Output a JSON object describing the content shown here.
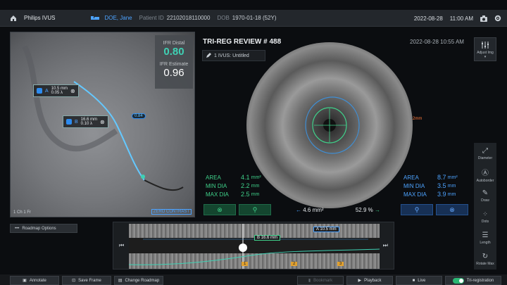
{
  "topbar": {
    "brand": "Philips IVUS",
    "patient_name": "DOE, Jane",
    "patient_id_label": "Patient ID",
    "patient_id": "22102018110000",
    "dob_label": "DOB",
    "dob": "1970-01-18 (52Y)",
    "date": "2022-08-28",
    "time": "11:00 AM"
  },
  "angio": {
    "ifr_distal_label": "IFR Distal",
    "ifr_distal_value": "0.80",
    "ifr_estimate_label": "IFR Estimate",
    "ifr_estimate_value": "0.96",
    "meas_a": {
      "letter": "A",
      "length": "10.5 mm",
      "value": "0.05 λ"
    },
    "meas_b": {
      "letter": "B",
      "length": "16.6 mm",
      "value": "0.10 λ"
    },
    "callout": "0.84",
    "zero_contrast": "ZERO CONTRAST",
    "frame_info": "1 Ch 1 Fr"
  },
  "review": {
    "title": "TRI-REG REVIEW # 488",
    "date": "2022-08-28 10:55 AM",
    "ivus_label": "1 IVUS: Untitled",
    "scale_label": "2mm"
  },
  "adjust": {
    "label": "Adjust Img"
  },
  "stats_left": [
    {
      "key": "AREA",
      "value": "4.1",
      "unit": "mm²"
    },
    {
      "key": "MIN DIA",
      "value": "2.2",
      "unit": "mm"
    },
    {
      "key": "MAX DIA",
      "value": "2.5",
      "unit": "mm"
    }
  ],
  "stats_right": [
    {
      "key": "AREA",
      "value": "8.7",
      "unit": "mm²"
    },
    {
      "key": "MIN DIA",
      "value": "3.5",
      "unit": "mm"
    },
    {
      "key": "MAX DIA",
      "value": "3.9",
      "unit": "mm"
    }
  ],
  "center_stats": {
    "area": "4.6 mm²",
    "percent": "52.9 %"
  },
  "tools": [
    {
      "label": "Diameter",
      "icon": "diameter-icon"
    },
    {
      "label": "Autoborder",
      "icon": "autoborder-icon"
    },
    {
      "label": "Draw",
      "icon": "draw-icon"
    },
    {
      "label": "Dots",
      "icon": "dots-icon"
    },
    {
      "label": "Length",
      "icon": "length-icon"
    },
    {
      "label": "Rotate Max",
      "icon": "rotate-icon"
    }
  ],
  "roadmap_options": "Roadmap Options",
  "longview": {
    "tag_a": "A 10.5 mm",
    "tag_b": "B 16.6 mm",
    "marker_1": "1",
    "marker_2": "2",
    "marker_3": "3"
  },
  "bottombar": {
    "annotate": "Annotate",
    "save_frame": "Save Frame",
    "change_roadmap": "Change Roadmap",
    "bookmark": "Bookmark",
    "playback": "Playback",
    "live": "Live",
    "tri_registration": "Tri-registration"
  },
  "colors": {
    "accent_green": "#3fd18a",
    "accent_blue": "#4da3ff",
    "teal": "#3fd1b4"
  }
}
